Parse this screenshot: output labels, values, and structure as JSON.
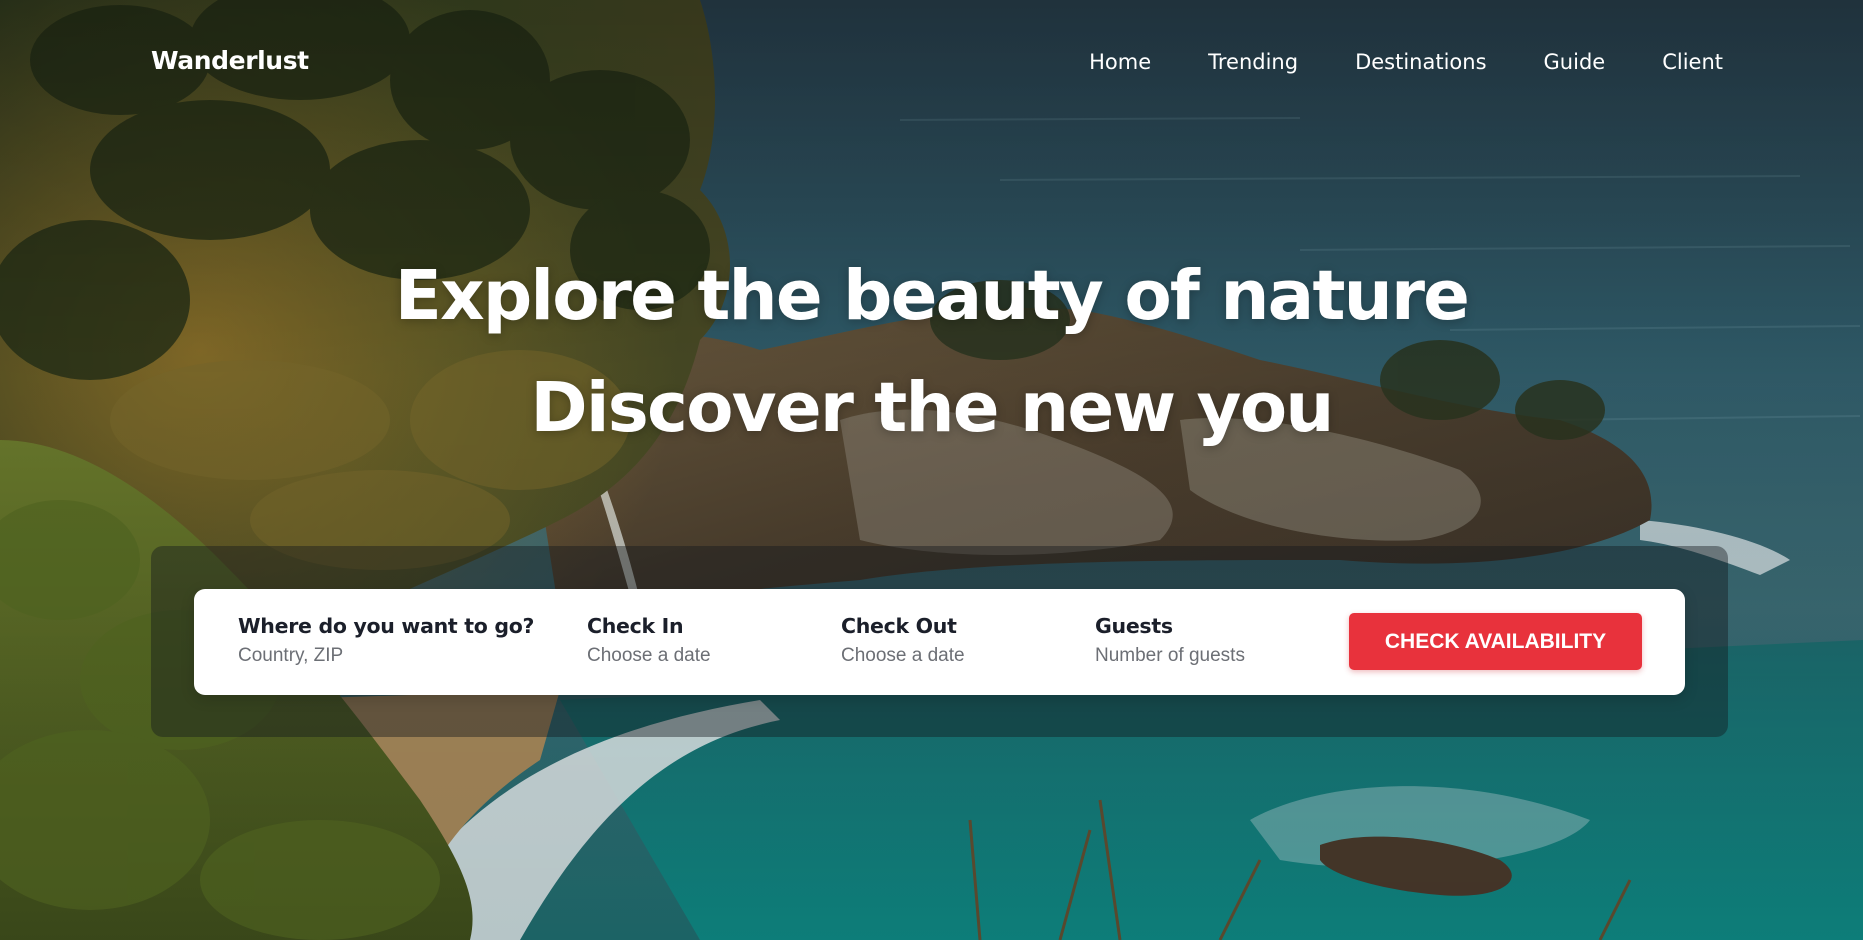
{
  "brand": {
    "name": "Wanderlust"
  },
  "nav": {
    "items": [
      {
        "label": "Home"
      },
      {
        "label": "Trending"
      },
      {
        "label": "Destinations"
      },
      {
        "label": "Guide"
      },
      {
        "label": "Client"
      }
    ]
  },
  "hero": {
    "line1": "Explore the beauty of nature",
    "line2": "Discover the new you"
  },
  "booking": {
    "destination": {
      "label": "Where do you want to go?",
      "placeholder": "Country, ZIP"
    },
    "check_in": {
      "label": "Check In",
      "placeholder": "Choose a date"
    },
    "check_out": {
      "label": "Check Out",
      "placeholder": "Choose a date"
    },
    "guests": {
      "label": "Guests",
      "placeholder": "Number of guests"
    },
    "cta_label": "CHECK AVAILABILITY"
  },
  "colors": {
    "accent": "#e8323c",
    "text_dark": "#1b1f2a",
    "text_muted": "#6c6f75",
    "nav_text": "#ffffff"
  }
}
